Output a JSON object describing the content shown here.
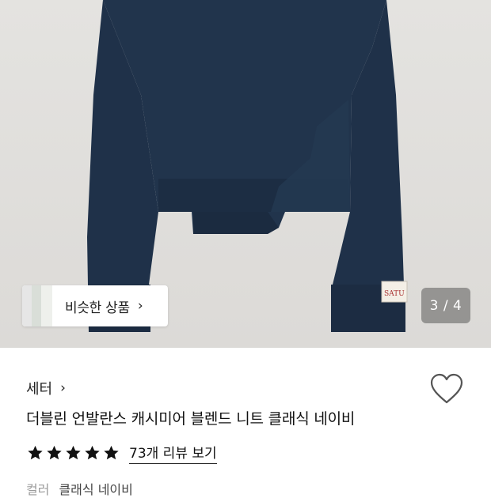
{
  "gallery": {
    "similar_label": "비슷한 상품",
    "counter": "3 / 4",
    "sweater_color": "#20324a",
    "tag_text": "SATU"
  },
  "product": {
    "category": "세터",
    "title": "더블린 언발란스 캐시미어 블렌드 니트 클래식 네이비",
    "rating": 5,
    "reviews_label": "73개 리뷰 보기",
    "color_label": "컬러",
    "color_value": "클래식 네이비"
  },
  "icons": {
    "chevron": "chevron-right-icon",
    "heart": "heart-outline-icon",
    "star": "star-filled-icon"
  }
}
